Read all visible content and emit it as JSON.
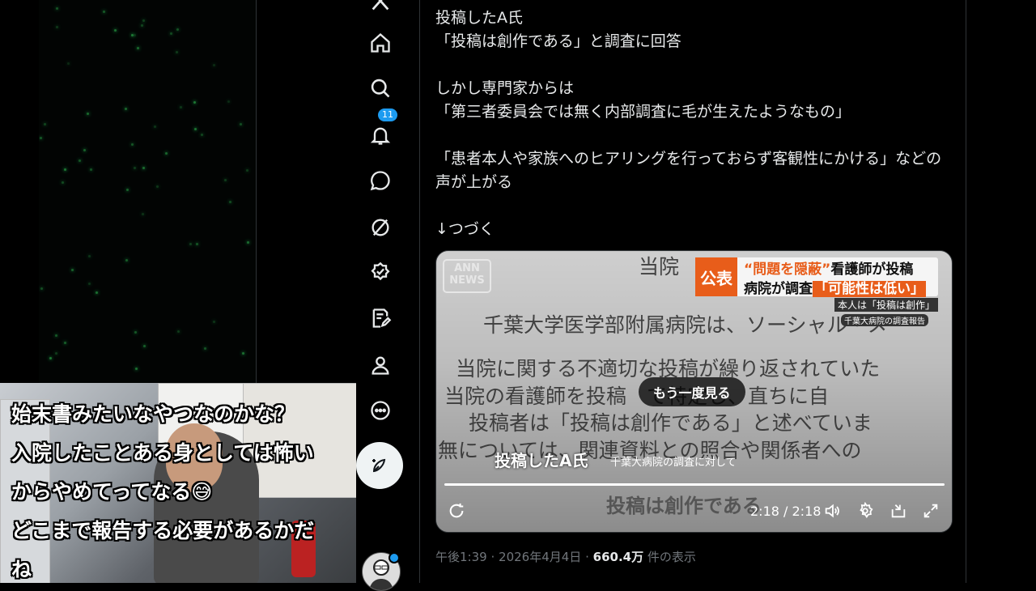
{
  "nav": {
    "notifications_count": "11",
    "items": [
      "x-logo-icon",
      "home-icon",
      "search-icon",
      "bell-icon",
      "chat-icon",
      "grok-icon",
      "verified-icon",
      "article-icon",
      "profile-icon",
      "more-icon"
    ]
  },
  "tweet": {
    "lines": [
      "投稿したA氏",
      "「投稿は創作である」と調査に回答",
      "",
      "しかし専門家からは",
      "「第三者委員会では無く内部調査に毛が生えたようなもの」",
      "",
      "「患者本人や家族へのヒアリングを行っておらず客観性にかける」などの",
      "声が上がる",
      "",
      "↓つづく"
    ]
  },
  "video": {
    "logo": "ANN\nNEWS",
    "kouhyo": "公表",
    "headline_1a": "“問題を隠蔽”",
    "headline_1b": "看護師が投稿",
    "headline_2a": "病院が調査",
    "headline_2b": "「可能性は低い」",
    "sub_1": "本人は「投稿は創作」",
    "sub_2": "千葉大病院の調査報告",
    "doc_lines": [
      "当院",
      "千葉大学医学部附属病院は、ソーシャル・メ",
      "当院に関する不適切な投稿が繰り返されていた",
      "当院の看護師を投稿　て特定し、直ちに自",
      "投稿者は「投稿は創作である」と述べていま",
      "無については、関連資料との照合や関係者への"
    ],
    "replay_label": "もう一度見る",
    "caption_speaker": "投稿したA氏",
    "caption_context": "千葉大病院の調査に対して",
    "subtitle": "投稿は創作である",
    "time": "2:18 / 2:18",
    "progress": 1.0
  },
  "meta": {
    "time": "午後1:39",
    "date": "2026年4月4日",
    "views": "660.4万",
    "views_suffix": "件の表示",
    "sep": "·"
  },
  "stream_comment": "始末書みたいなやつなのかな？\n入院したことある身としては怖い\nからやめてってなる😅\nどこまで報告する必要があるかだ\nね",
  "colors": {
    "accent": "#1d9bf0",
    "headline_orange": "#e85d1a"
  }
}
